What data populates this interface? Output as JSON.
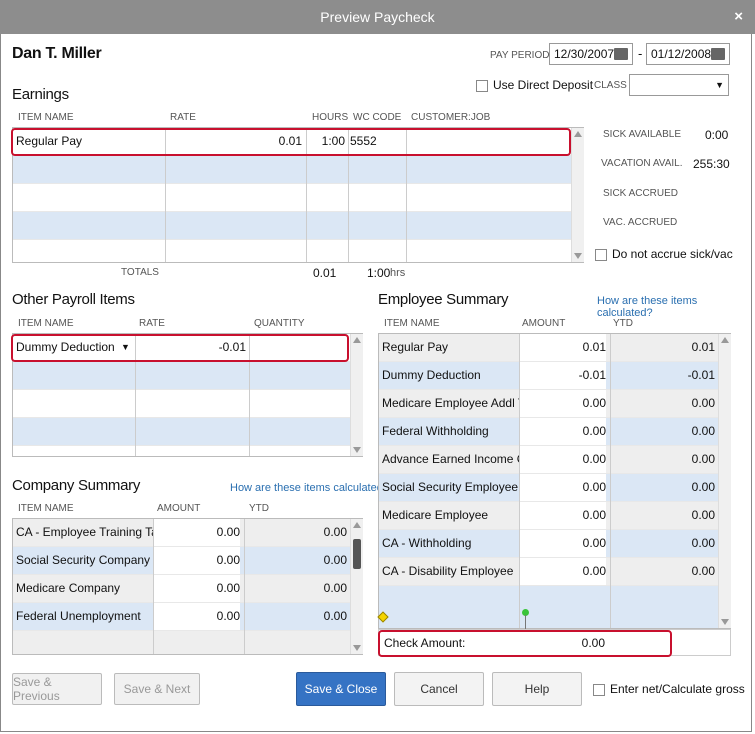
{
  "window": {
    "title": "Preview Paycheck",
    "close": "×"
  },
  "employee": {
    "name": "Dan T. Miller"
  },
  "pay_period": {
    "label": "PAY PERIOD",
    "start": "12/30/2007",
    "dash": "-",
    "end": "01/12/2008"
  },
  "direct_deposit": {
    "label": "Use Direct Deposit",
    "checked": false
  },
  "class_label": "CLASS",
  "earnings": {
    "title": "Earnings",
    "headers": [
      "ITEM NAME",
      "RATE",
      "HOURS",
      "WC CODE",
      "CUSTOMER:JOB"
    ],
    "rows": [
      {
        "item": "Regular Pay",
        "rate": "0.01",
        "hours": "1:00",
        "wc": "5552",
        "job": ""
      }
    ],
    "totals_label": "TOTALS",
    "totals_rate": "0.01",
    "totals_hours": "1:00",
    "hrs": "hrs"
  },
  "sick_vac": {
    "sick_available_label": "SICK AVAILABLE",
    "sick_available": "0:00",
    "vacation_avail_label": "VACATION AVAIL.",
    "vacation_avail": "255:30",
    "sick_accrued_label": "SICK ACCRUED",
    "vac_accrued_label": "VAC. ACCRUED",
    "do_not_accrue": "Do not accrue sick/vac"
  },
  "other_payroll": {
    "title": "Other Payroll Items",
    "headers": [
      "ITEM NAME",
      "RATE",
      "QUANTITY"
    ],
    "rows": [
      {
        "item": "Dummy Deduction",
        "rate": "-0.01",
        "qty": ""
      }
    ]
  },
  "employee_summary": {
    "title": "Employee Summary",
    "link": "How are these items calculated?",
    "headers": [
      "ITEM NAME",
      "AMOUNT",
      "YTD"
    ],
    "rows": [
      {
        "item": "Regular Pay",
        "amount": "0.01",
        "ytd": "0.01"
      },
      {
        "item": "Dummy Deduction",
        "amount": "-0.01",
        "ytd": "-0.01"
      },
      {
        "item": "Medicare Employee Addl Tax",
        "amount": "0.00",
        "ytd": "0.00"
      },
      {
        "item": "Federal Withholding",
        "amount": "0.00",
        "ytd": "0.00"
      },
      {
        "item": "Advance Earned Income Cr...",
        "amount": "0.00",
        "ytd": "0.00"
      },
      {
        "item": "Social Security Employee",
        "amount": "0.00",
        "ytd": "0.00"
      },
      {
        "item": "Medicare Employee",
        "amount": "0.00",
        "ytd": "0.00"
      },
      {
        "item": "CA - Withholding",
        "amount": "0.00",
        "ytd": "0.00"
      },
      {
        "item": "CA - Disability Employee",
        "amount": "0.00",
        "ytd": "0.00"
      }
    ],
    "check_amount_label": "Check Amount:",
    "check_amount": "0.00"
  },
  "company_summary": {
    "title": "Company Summary",
    "link": "How are these items calculated?",
    "headers": [
      "ITEM NAME",
      "AMOUNT",
      "YTD"
    ],
    "rows": [
      {
        "item": "CA - Employee Training Tax",
        "amount": "0.00",
        "ytd": "0.00"
      },
      {
        "item": "Social Security Company",
        "amount": "0.00",
        "ytd": "0.00"
      },
      {
        "item": "Medicare Company",
        "amount": "0.00",
        "ytd": "0.00"
      },
      {
        "item": "Federal Unemployment",
        "amount": "0.00",
        "ytd": "0.00"
      }
    ]
  },
  "buttons": {
    "save_previous": "Save & Previous",
    "save_next": "Save & Next",
    "save_close": "Save & Close",
    "cancel": "Cancel",
    "help": "Help",
    "enter_net": "Enter net/Calculate gross"
  }
}
